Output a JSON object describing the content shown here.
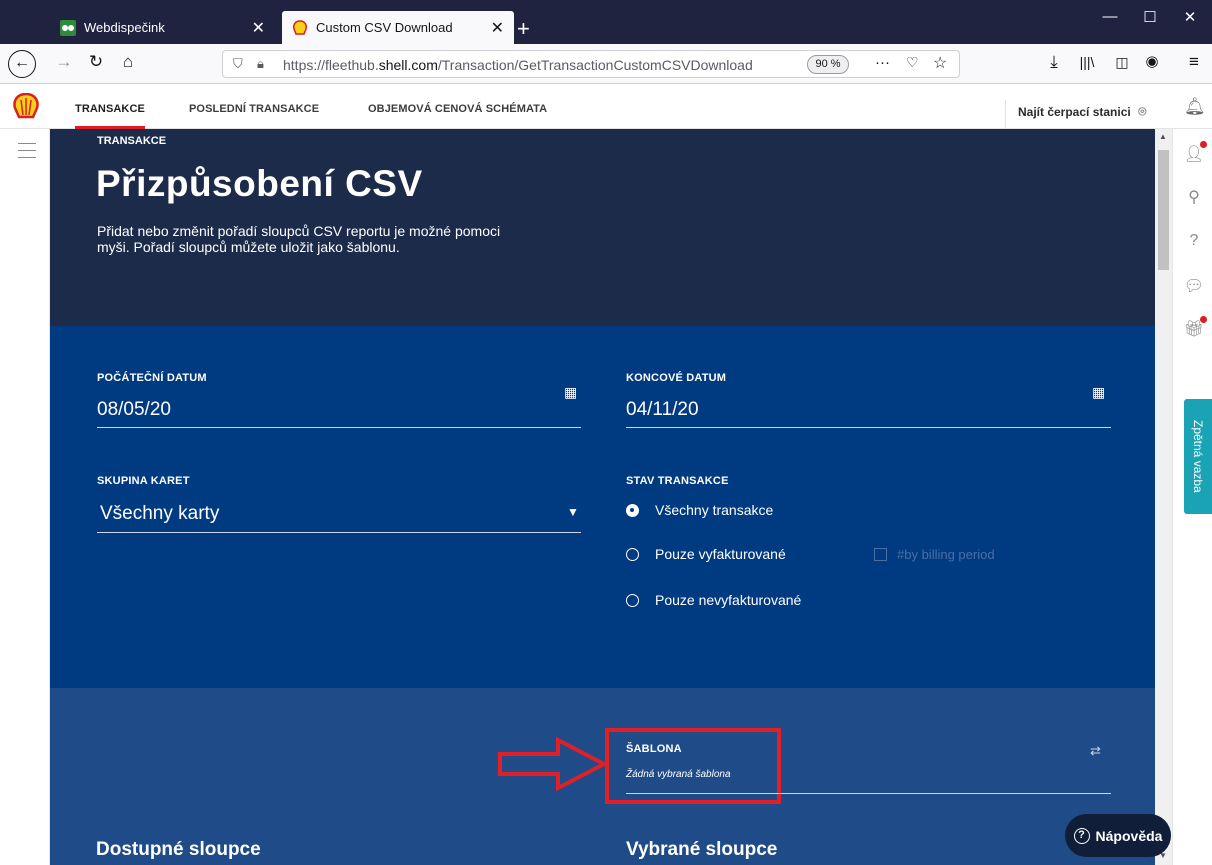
{
  "browser": {
    "tabs": [
      {
        "title": "Webdispečink"
      },
      {
        "title": "Custom CSV Download"
      }
    ],
    "url_prefix": "https://fleethub.",
    "url_domain": "shell.com",
    "url_path": "/Transaction/GetTransactionCustomCSVDownload",
    "zoom": "90 %"
  },
  "nav": {
    "items": [
      "TRANSAKCE",
      "POSLEDNÍ TRANSAKCE",
      "OBJEMOVÁ CENOVÁ SCHÉMATA"
    ],
    "find_station": "Najít čerpací stanici"
  },
  "hero": {
    "breadcrumb": "TRANSAKCE",
    "title": "Přizpůsobení CSV",
    "desc_line1": "Přidat nebo změnit pořadí sloupců CSV reportu je možné pomoci",
    "desc_line2": "myši. Pořadí sloupců můžete uložit jako šablonu."
  },
  "form": {
    "start_label": "POČÁTEČNÍ DATUM",
    "start_value": "08/05/20",
    "end_label": "KONCOVÉ DATUM",
    "end_value": "04/11/20",
    "cards_label": "SKUPINA KARET",
    "cards_value": "Všechny karty",
    "status_label": "STAV TRANSAKCE",
    "status_options": [
      "Všechny transakce",
      "Pouze vyfakturované",
      "Pouze nevyfakturované"
    ],
    "billing_period": "#by billing period",
    "template_label": "ŠABLONA",
    "template_value": "Žádná vybraná šablona",
    "available_title": "Dostupné sloupce",
    "selected_title": "Vybrané sloupce"
  },
  "help_label": "Nápověda",
  "feedback_label": "Zpětná vazba",
  "colors": {
    "accent": "#dd1d21",
    "hero": "#1d2b4b",
    "form": "#003a80",
    "form2": "#1f4c88"
  }
}
